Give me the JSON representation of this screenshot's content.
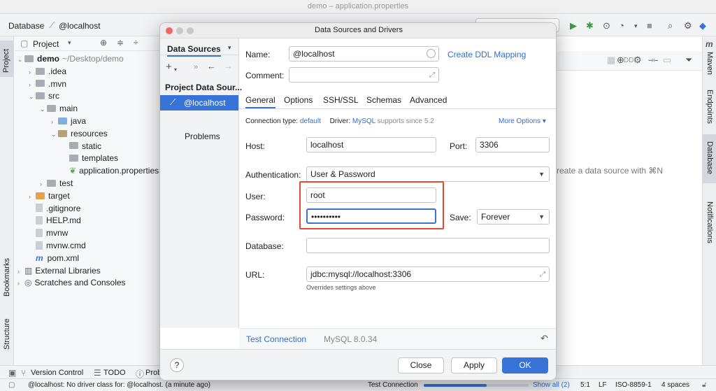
{
  "window": {
    "title": "demo – application.properties"
  },
  "navbar": {
    "crumb_database": "Database",
    "crumb_host": "@localhost"
  },
  "project_panel": {
    "title": "Project",
    "tree": [
      {
        "label": "demo",
        "suffix": "~/Desktop/demo",
        "indent": 0,
        "icon": "folder",
        "expanded": true
      },
      {
        "label": ".idea",
        "indent": 1,
        "icon": "folder",
        "expanded": false
      },
      {
        "label": ".mvn",
        "indent": 1,
        "icon": "folder",
        "expanded": false
      },
      {
        "label": "src",
        "indent": 1,
        "icon": "folder",
        "expanded": true
      },
      {
        "label": "main",
        "indent": 2,
        "icon": "folder",
        "expanded": true
      },
      {
        "label": "java",
        "indent": 3,
        "icon": "folder-blue",
        "expanded": false
      },
      {
        "label": "resources",
        "indent": 3,
        "icon": "folder-res",
        "expanded": true
      },
      {
        "label": "static",
        "indent": 4,
        "icon": "folder"
      },
      {
        "label": "templates",
        "indent": 4,
        "icon": "folder"
      },
      {
        "label": "application.properties",
        "indent": 4,
        "icon": "file-leaf"
      },
      {
        "label": "test",
        "indent": 2,
        "icon": "folder",
        "expanded": false
      },
      {
        "label": "target",
        "indent": 1,
        "icon": "folder-orange",
        "expanded": false
      },
      {
        "label": ".gitignore",
        "indent": 1,
        "icon": "file"
      },
      {
        "label": "HELP.md",
        "indent": 1,
        "icon": "file"
      },
      {
        "label": "mvnw",
        "indent": 1,
        "icon": "file"
      },
      {
        "label": "mvnw.cmd",
        "indent": 1,
        "icon": "file"
      },
      {
        "label": "pom.xml",
        "indent": 1,
        "icon": "file-m"
      },
      {
        "label": "External Libraries",
        "indent": 0,
        "icon": "libs",
        "expanded": false
      },
      {
        "label": "Scratches and Consoles",
        "indent": 0,
        "icon": "scratch",
        "expanded": false
      }
    ]
  },
  "left_strip": {
    "project": "Project",
    "bookmarks": "Bookmarks",
    "structure": "Structure"
  },
  "right_strip": {
    "maven": "Maven",
    "endpoints": "Endpoints",
    "database": "Database",
    "notifications": "Notifications"
  },
  "editor": {
    "hint": "reate a data source with ⌘N",
    "ddl": "DDL"
  },
  "bottom_bar": {
    "version_control": "Version Control",
    "todo": "TODO",
    "problems": "Prob"
  },
  "status_bar": {
    "message": "@localhost: No driver class for: @localhost. (a minute ago)",
    "task": "Test Connection",
    "show_all": "Show all (2)",
    "position": "5:1",
    "line_sep": "LF",
    "encoding": "ISO-8859-1",
    "indent": "4 spaces"
  },
  "dialog": {
    "title": "Data Sources and Drivers",
    "left": {
      "tab_label": "Data Sources",
      "section_header": "Project Data Sour...",
      "selected_source": "@localhost",
      "problems": "Problems"
    },
    "name_label": "Name:",
    "name_value": "@localhost",
    "create_ddl": "Create DDL Mapping",
    "comment_label": "Comment:",
    "comment_value": "",
    "tabs": [
      "General",
      "Options",
      "SSH/SSL",
      "Schemas",
      "Advanced"
    ],
    "active_tab": "General",
    "conn_type_label": "Connection type:",
    "conn_type_value": "default",
    "driver_label": "Driver:",
    "driver_value": "MySQL",
    "driver_suffix": "supports since 5.2",
    "more_options": "More Options",
    "host_label": "Host:",
    "host_value": "localhost",
    "port_label": "Port:",
    "port_value": "3306",
    "auth_label": "Authentication:",
    "auth_value": "User & Password",
    "user_label": "User:",
    "user_value": "root",
    "password_label": "Password:",
    "password_value": "••••••••••",
    "save_label": "Save:",
    "save_value": "Forever",
    "database_label": "Database:",
    "database_value": "",
    "url_label": "URL:",
    "url_value": "jdbc:mysql://localhost:3306",
    "url_note": "Overrides settings above",
    "test_connection": "Test Connection",
    "server_version": "MySQL 8.0.34",
    "buttons": {
      "help": "?",
      "close": "Close",
      "apply": "Apply",
      "ok": "OK"
    }
  },
  "colors": {
    "accent": "#3874d8",
    "highlight": "#e24a32",
    "selected_source_bg": "#3874d8"
  }
}
